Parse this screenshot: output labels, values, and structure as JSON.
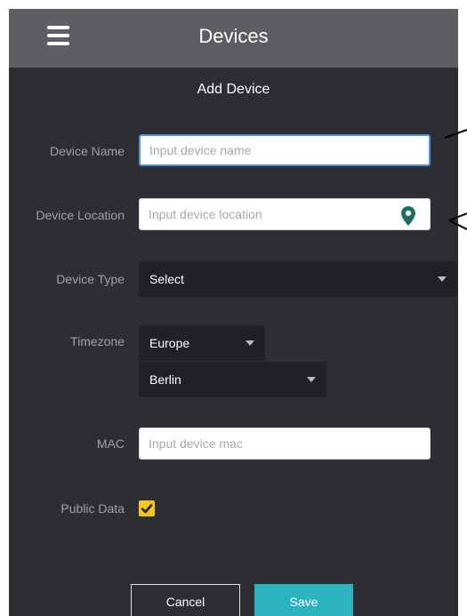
{
  "app_bar": {
    "title": "Devices",
    "menu_icon": "hamburger-menu-icon"
  },
  "form": {
    "title": "Add Device",
    "device_name": {
      "label": "Device Name",
      "placeholder": "Input device name",
      "value": ""
    },
    "device_location": {
      "label": "Device Location",
      "placeholder": "Input device location",
      "value": "",
      "icon": "location-pin-icon"
    },
    "device_type": {
      "label": "Device Type",
      "selected": "Select"
    },
    "timezone": {
      "label": "Timezone",
      "region": "Europe",
      "city": "Berlin"
    },
    "mac": {
      "label": "MAC",
      "placeholder": "Input device mac",
      "value": ""
    },
    "public_data": {
      "label": "Public Data",
      "checked": true
    }
  },
  "actions": {
    "cancel_label": "Cancel",
    "save_label": "Save"
  },
  "colors": {
    "background": "#2c2e33",
    "app_bar": "#5d5e61",
    "select_bg": "#1f2125",
    "accent_save": "#2bb3c0",
    "checkbox": "#f5c518",
    "pin": "#1e6e63",
    "focus_border": "#4a90e2"
  }
}
